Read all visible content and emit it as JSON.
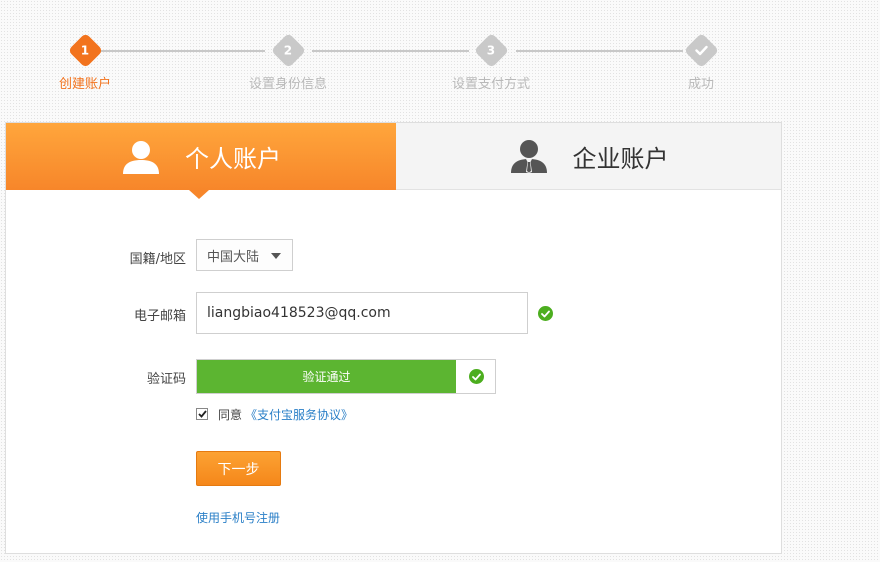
{
  "stepper": {
    "steps": [
      {
        "number": "1",
        "label": "创建账户",
        "state": "active"
      },
      {
        "number": "2",
        "label": "设置身份信息",
        "state": "pending"
      },
      {
        "number": "3",
        "label": "设置支付方式",
        "state": "pending"
      },
      {
        "number": "",
        "label": "成功",
        "state": "pending",
        "icon": "check-icon"
      }
    ]
  },
  "tabs": {
    "personal": {
      "label": "个人账户",
      "icon": "user-icon",
      "selected": true
    },
    "enterprise": {
      "label": "企业账户",
      "icon": "business-user-icon",
      "selected": false
    }
  },
  "form": {
    "nationality": {
      "label": "国籍/地区",
      "value": "中国大陆"
    },
    "email": {
      "label": "电子邮箱",
      "value": "liangbiao418523@qq.com",
      "status_icon": "check-circle-icon"
    },
    "captcha": {
      "label": "验证码",
      "status_text": "验证通过",
      "status_icon": "check-circle-icon"
    },
    "agreement": {
      "checked": true,
      "text": "同意",
      "link": "《支付宝服务协议》"
    },
    "next_button": "下一步",
    "phone_link": "使用手机号注册"
  },
  "colors": {
    "accent": "#f7862a",
    "step_active": "#f2731d",
    "success": "#5cb531",
    "link": "#2a7fc7"
  }
}
